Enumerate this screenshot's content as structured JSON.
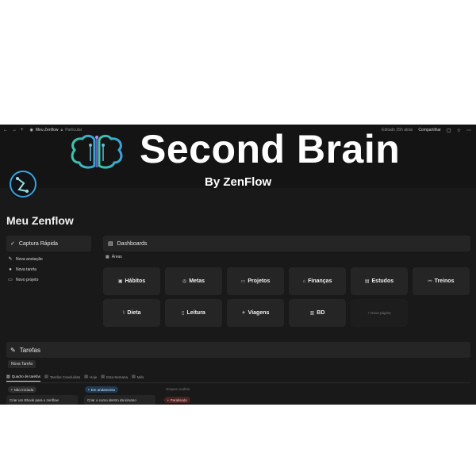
{
  "topbar": {
    "nav": [
      "←",
      "→",
      "+"
    ],
    "page_name": "Meu Zenflow",
    "privacy": "Particular",
    "edited": "Editado 25h atrás",
    "share": "Compartilhar"
  },
  "cover": {
    "headline": "Second Brain",
    "byline": "By ZenFlow"
  },
  "page": {
    "title": "Meu Zenflow"
  },
  "quick_capture": {
    "title": "Captura Rápida",
    "items": [
      {
        "label": "Nova anotação",
        "icon": "edit-icon"
      },
      {
        "label": "Nova tarefa",
        "icon": "check-icon"
      },
      {
        "label": "Novo projeto",
        "icon": "folder-icon"
      }
    ]
  },
  "dashboards": {
    "title": "Dashboards",
    "view_label": "Áreas",
    "cards": [
      {
        "label": "Hábitos",
        "icon": "▣"
      },
      {
        "label": "Metas",
        "icon": "◎"
      },
      {
        "label": "Projetos",
        "icon": "▭"
      },
      {
        "label": "Finanças",
        "icon": "⌂"
      },
      {
        "label": "Estudos",
        "icon": "▤"
      },
      {
        "label": "Treinos",
        "icon": "⚯"
      },
      {
        "label": "Dieta",
        "icon": "⌇"
      },
      {
        "label": "Leitura",
        "icon": "▯"
      },
      {
        "label": "Viagens",
        "icon": "✈"
      },
      {
        "label": "BD",
        "icon": "▥"
      }
    ],
    "new_page": "+ Nova página"
  },
  "tasks": {
    "title": "Tarefas",
    "new_button": "Nova Tarefa",
    "tabs": [
      {
        "label": "Quadro de tarefas",
        "active": true
      },
      {
        "label": "Tarefas Concluídas",
        "active": false
      },
      {
        "label": "Hoje",
        "active": false
      },
      {
        "label": "Esta Semana",
        "active": false
      },
      {
        "label": "Mês",
        "active": false
      }
    ],
    "columns": {
      "not_started": "Não iniciada",
      "in_progress": "Em andamento",
      "hidden_groups": "Grupos ocultos",
      "paused": "Paralisado"
    },
    "cards": [
      "Criar um Ebook para o zenflow",
      "Criar o curso dentro da kirvano"
    ]
  },
  "colors": {
    "background": "#191919",
    "panel": "#252525",
    "in_progress_badge": "#1f3a52",
    "paused_badge": "#4a2222"
  }
}
